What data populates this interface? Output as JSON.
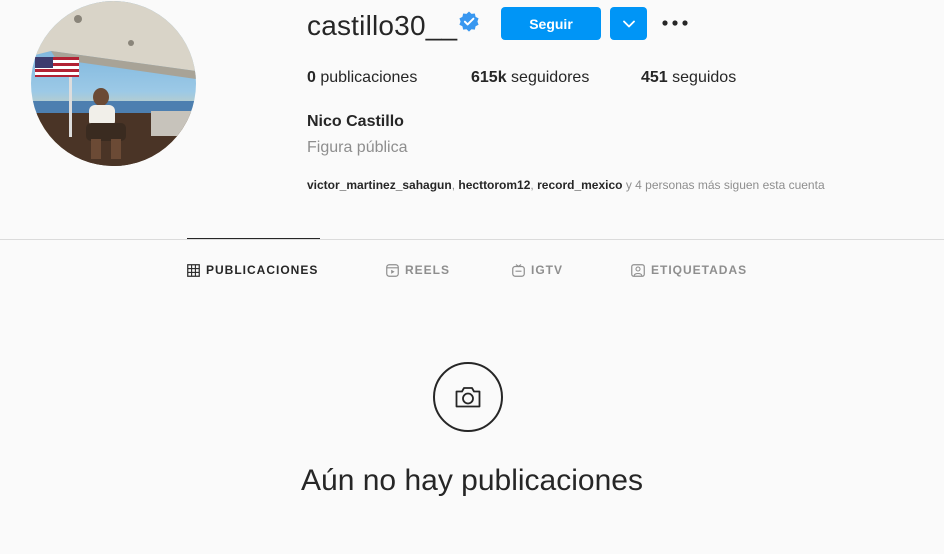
{
  "profile": {
    "username": "castillo30__",
    "verified": true,
    "follow_label": "Seguir",
    "stats": {
      "posts_count": "0",
      "posts_label": "publicaciones",
      "followers_count": "615k",
      "followers_label": "seguidores",
      "following_count": "451",
      "following_label": "seguidos"
    },
    "full_name": "Nico Castillo",
    "category": "Figura pública",
    "followed_by": {
      "users": [
        "victor_martinez_sahagun",
        "hecttorom12",
        "record_mexico"
      ],
      "suffix": "y 4 personas más siguen esta cuenta"
    }
  },
  "tabs": [
    {
      "label": "PUBLICACIONES",
      "icon": "grid-icon",
      "active": true
    },
    {
      "label": "REELS",
      "icon": "reels-icon",
      "active": false
    },
    {
      "label": "IGTV",
      "icon": "igtv-icon",
      "active": false
    },
    {
      "label": "ETIQUETADAS",
      "icon": "tagged-icon",
      "active": false
    }
  ],
  "empty_state": {
    "icon": "camera-icon",
    "message": "Aún no hay publicaciones"
  },
  "colors": {
    "accent": "#0095f6",
    "verified": "#3897f0",
    "background": "#fafafa",
    "text": "#262626",
    "secondary_text": "#8e8e8e"
  }
}
